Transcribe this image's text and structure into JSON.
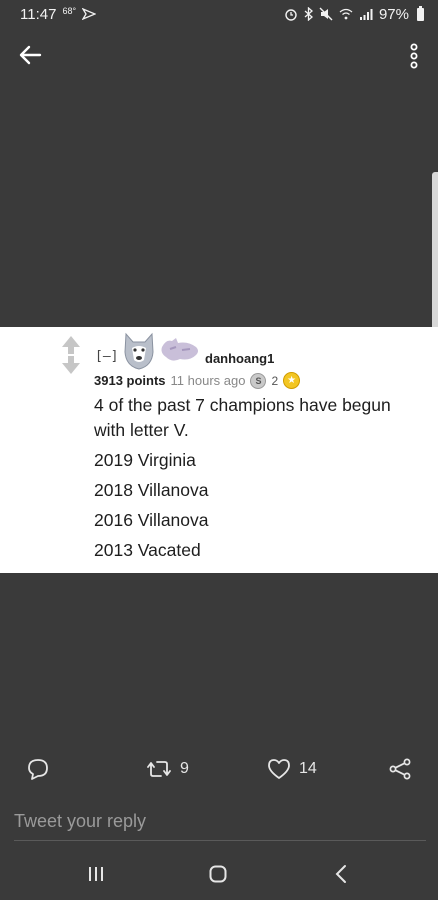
{
  "status_bar": {
    "time": "11:47",
    "temperature": "68°",
    "battery": "97%",
    "icons": [
      "alarm-icon",
      "bluetooth-icon",
      "mute-icon",
      "wifi-icon",
      "signal-icon",
      "battery-icon"
    ]
  },
  "app_bar": {
    "back_icon": "arrow-left-icon",
    "more_icon": "more-vertical-icon"
  },
  "comment": {
    "collapse_label": "[–]",
    "username": "danhoang1",
    "points": "3913 points",
    "time_ago": "11 hours ago",
    "award_count": "2",
    "lines": [
      "4 of the past 7 champions have begun with letter V.",
      "2019 Virginia",
      "2018 Villanova",
      "2016 Villanova",
      "2013 Vacated"
    ]
  },
  "actions": {
    "retweet_count": "9",
    "like_count": "14"
  },
  "reply": {
    "placeholder": "Tweet your reply"
  },
  "colors": {
    "background": "#3a3a3a",
    "card": "#ffffff",
    "icon": "#e6e6e6",
    "gold_award": "#f3c623"
  }
}
